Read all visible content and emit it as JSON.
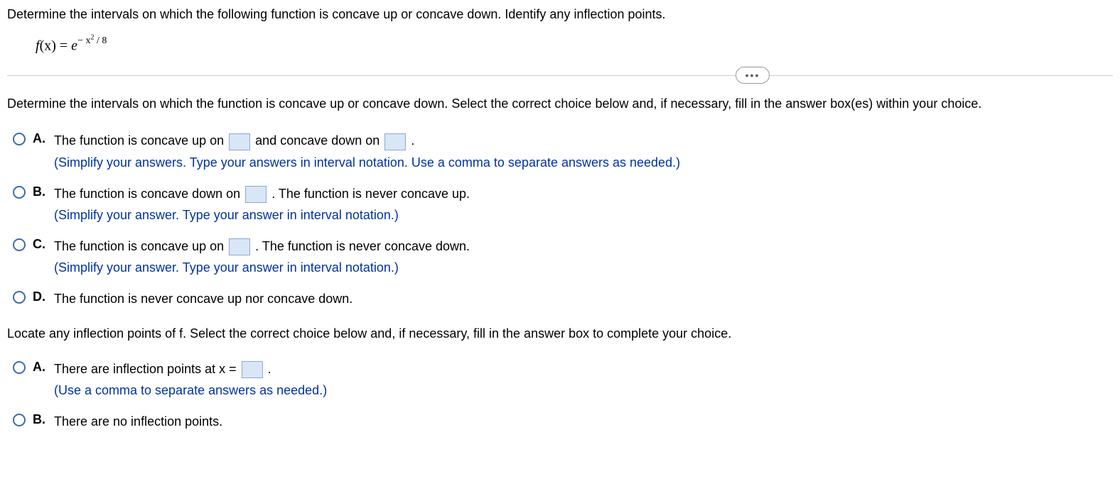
{
  "question": {
    "prompt": "Determine the intervals on which the following function is concave up or concave down. Identify any inflection points.",
    "formula_prefix": "f(x) = ",
    "formula_base": "e",
    "formula_exponent": "−x² / 8"
  },
  "ellipsis": "•••",
  "part1": {
    "instruction": "Determine the intervals on which the function is concave up or concave down. Select the correct choice below and, if necessary, fill in the answer box(es) within your choice.",
    "choices": {
      "A": {
        "letter": "A.",
        "text_before_1": "The function is concave up on ",
        "text_mid": " and concave down on ",
        "text_after": ".",
        "hint": "(Simplify your answers. Type your answers in interval notation. Use a comma to separate answers as needed.)"
      },
      "B": {
        "letter": "B.",
        "text_before_1": "The function is concave down on ",
        "text_after": ". The function is never concave up.",
        "hint": "(Simplify your answer. Type your answer in interval notation.)"
      },
      "C": {
        "letter": "C.",
        "text_before_1": "The function is concave up on ",
        "text_after": ". The function is never concave down.",
        "hint": "(Simplify your answer. Type your answer in interval notation.)"
      },
      "D": {
        "letter": "D.",
        "text": "The function is never concave up nor concave down."
      }
    }
  },
  "part2": {
    "instruction": "Locate any inflection points of f. Select the correct choice below and, if necessary, fill in the answer box to complete your choice.",
    "choices": {
      "A": {
        "letter": "A.",
        "text_before_1": "There are inflection points at x = ",
        "text_after": ".",
        "hint": "(Use a comma to separate answers as needed.)"
      },
      "B": {
        "letter": "B.",
        "text": "There are no inflection points."
      }
    }
  }
}
